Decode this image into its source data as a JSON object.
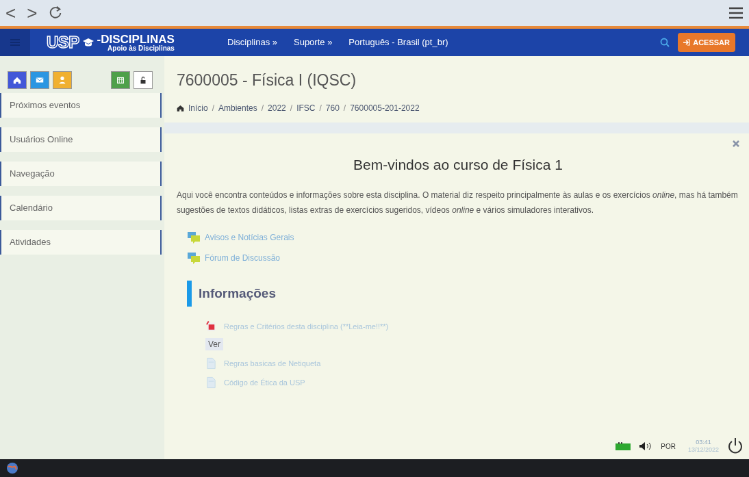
{
  "browser": {
    "back": "<",
    "forward": ">"
  },
  "navbar": {
    "logo_mark": "USP",
    "logo_title": "-DISCIPLINAS",
    "logo_subtitle": "Apoio às Disciplinas",
    "menu": [
      "Disciplinas »",
      "Suporte »",
      "Português - Brasil (pt_br)"
    ],
    "login_button": "ACESSAR"
  },
  "sidebar": {
    "blocks": [
      "Próximos eventos",
      "Usuários Online",
      "Navegação",
      "Calendário",
      "Atividades"
    ]
  },
  "course": {
    "title": "7600005 - Física I (IQSC)",
    "breadcrumb": [
      {
        "kind": "link",
        "text": "Início"
      },
      {
        "kind": "separator",
        "text": "/"
      },
      {
        "kind": "link",
        "text": "Ambientes"
      },
      {
        "kind": "separator",
        "text": "/"
      },
      {
        "kind": "link",
        "text": "2022"
      },
      {
        "kind": "separator",
        "text": "/"
      },
      {
        "kind": "link",
        "text": "IFSC"
      },
      {
        "kind": "separator",
        "text": "/"
      },
      {
        "kind": "link",
        "text": "760"
      },
      {
        "kind": "separator",
        "text": "/"
      },
      {
        "kind": "link",
        "text": "7600005-201-2022"
      }
    ]
  },
  "welcome": {
    "heading": "Bem-vindos ao curso de Física 1",
    "text": "Aqui você encontra conteúdos e informações sobre esta disciplina. O material diz respeito principalmente às aulas e os exercícios *online*, mas há também sugestões de textos didáticos, listas extras de exercícios sugeridos, vídeos *online* e vários simuladores interativos."
  },
  "forums": [
    "Avisos e Notícias Gerais",
    "Fórum de Discussão"
  ],
  "section": {
    "title": "Informações",
    "items": [
      {
        "kind": "pdf",
        "label": "Regras e Critérios desta disciplina (**Leia-me!!**)",
        "action": "Ver"
      },
      {
        "kind": "page",
        "label": "Regras basicas de Netiqueta"
      },
      {
        "kind": "page",
        "label": "Código de Ética da USP"
      }
    ]
  },
  "taskbar": {
    "language": "POR",
    "time": "03:41",
    "date": "13/12/2022"
  }
}
